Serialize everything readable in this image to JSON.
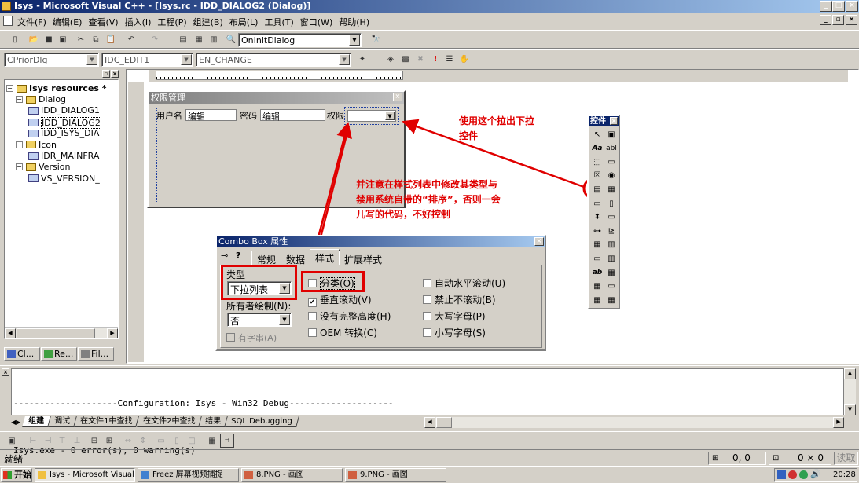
{
  "window": {
    "title": "Isys - Microsoft Visual C++ - [Isys.rc - IDD_DIALOG2 (Dialog)]"
  },
  "menu": [
    "文件(F)",
    "编辑(E)",
    "查看(V)",
    "插入(I)",
    "工程(P)",
    "组建(B)",
    "布局(L)",
    "工具(T)",
    "窗口(W)",
    "帮助(H)"
  ],
  "toolbar": {
    "function_combo": "OnInitDialog"
  },
  "wizardbar": {
    "class": "CPriorDlg",
    "id": "IDC_EDIT1",
    "message": "EN_CHANGE"
  },
  "tree": {
    "root": "Isys resources *",
    "items": [
      {
        "label": "Dialog",
        "level": 1,
        "icon": "folder"
      },
      {
        "label": "IDD_DIALOG1",
        "level": 2,
        "icon": "dialog"
      },
      {
        "label": "IDD_DIALOG2",
        "level": 2,
        "icon": "dialog"
      },
      {
        "label": "IDD_ISYS_DIA",
        "level": 2,
        "icon": "dialog"
      },
      {
        "label": "Icon",
        "level": 1,
        "icon": "folder"
      },
      {
        "label": "IDR_MAINFRA",
        "level": 2,
        "icon": "icon"
      },
      {
        "label": "Version",
        "level": 1,
        "icon": "folder"
      },
      {
        "label": "VS_VERSION_",
        "level": 2,
        "icon": "version"
      }
    ],
    "tabs": [
      "Cl...",
      "Re...",
      "Fil..."
    ]
  },
  "dialog": {
    "title": "权限管理",
    "user_label": "用户名",
    "user_value": "编辑",
    "pwd_label": "密码",
    "pwd_value": "编辑",
    "perm_label": "权限"
  },
  "annotations": {
    "a1": "使用这个拉出下拉控件",
    "a2": "并注意在样式列表中修改其类型与禁用系统自带的“排序”，否则一会儿写的代码，不好控制"
  },
  "controls_palette": {
    "title": "控件"
  },
  "props": {
    "title": "Combo Box 属性",
    "tabs": [
      "常规",
      "数据",
      "样式",
      "扩展样式"
    ],
    "type_label": "类型",
    "type_value": "下拉列表",
    "owner_label": "所有者绘制(N):",
    "owner_value": "否",
    "has_strings": "有字串(A)",
    "col1": [
      {
        "label": "分类(O)",
        "checked": false
      },
      {
        "label": "垂直滚动(V)",
        "checked": true
      },
      {
        "label": "没有完整高度(H)",
        "checked": false
      },
      {
        "label": "OEM 转换(C)",
        "checked": false
      }
    ],
    "col2": [
      {
        "label": "自动水平滚动(U)",
        "checked": false
      },
      {
        "label": "禁止不滚动(B)",
        "checked": false
      },
      {
        "label": "大写字母(P)",
        "checked": false
      },
      {
        "label": "小写字母(S)",
        "checked": false
      }
    ]
  },
  "output": {
    "line1": "--------------------Configuration: Isys - Win32 Debug--------------------",
    "line2": "Isys.exe - 0 error(s), 0 warning(s)",
    "tabs": [
      "组建",
      "调试",
      "在文件1中查找",
      "在文件2中查找",
      "结果",
      "SQL Debugging"
    ]
  },
  "status": {
    "text": "就绪",
    "pos": "0, 0",
    "size": "0 × 0",
    "mode": "读取"
  },
  "taskbar": {
    "start": "开始",
    "items": [
      "Isys - Microsoft Visual C...",
      "Freez 屏幕视频捕捉",
      "8.PNG - 画图",
      "9.PNG - 画图"
    ],
    "clock": "20:28"
  }
}
